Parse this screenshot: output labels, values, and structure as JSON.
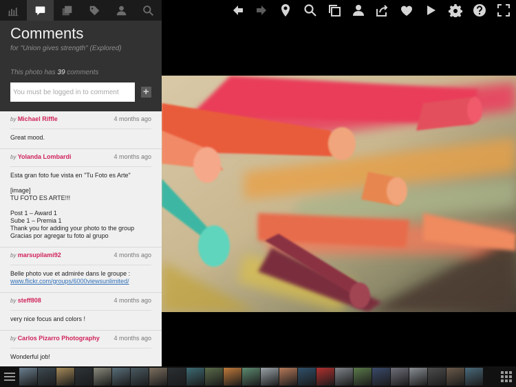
{
  "panel_tabs": [
    {
      "name": "stats-tab",
      "icon": "bar-chart-icon",
      "active": false
    },
    {
      "name": "comments-tab",
      "icon": "speech-bubble-icon",
      "active": true
    },
    {
      "name": "sets-tab",
      "icon": "stacked-pages-icon",
      "active": false
    },
    {
      "name": "tags-tab",
      "icon": "tag-icon",
      "active": false
    },
    {
      "name": "people-tab",
      "icon": "person-icon",
      "active": false
    },
    {
      "name": "search-tab",
      "icon": "search-icon",
      "active": false
    }
  ],
  "comments": {
    "title": "Comments",
    "subtitle": "for \"Union gives strength\" (Explored)",
    "count_prefix": "This photo has",
    "count": "39",
    "count_suffix": "comments",
    "input_placeholder": "You must be logged in to comment",
    "add_label": "+",
    "by_label": "by",
    "items": [
      {
        "author": "Michael Riffle",
        "time": "4 months ago",
        "body": "Great mood.",
        "link": ""
      },
      {
        "author": "Yolanda Lombardi",
        "time": "4 months ago",
        "body": "Esta gran foto fue vista en \"Tu Foto es Arte\"\n\n[image]\nTU FOTO ES ARTE!!!\n\nPost 1 – Award 1\nSube 1 – Premia 1\nThank you for adding your photo to the group\nGracias por agregar tu foto al grupo",
        "link": ""
      },
      {
        "author": "marsupilami92",
        "time": "4 months ago",
        "body": "Belle photo vue et admirée dans le groupe :",
        "link": "www.flickr.com/groups/6000viewsunlimited/"
      },
      {
        "author": "steff808",
        "time": "4 months ago",
        "body": "very nice focus and colors !",
        "link": ""
      },
      {
        "author": "Carlos Pizarro Photography",
        "time": "4 months ago",
        "body": "Wonderful job!",
        "link": ""
      }
    ]
  },
  "toolbar": {
    "icons": [
      "back-arrow-icon",
      "forward-arrow-icon",
      "location-pin-icon",
      "zoom-icon",
      "copy-icon",
      "user-icon",
      "share-icon",
      "heart-icon",
      "play-icon",
      "settings-gear-icon",
      "help-icon",
      "fullscreen-icon"
    ]
  },
  "filmstrip": {
    "menu_icon": "menu-icon",
    "grid_icon": "grid-icon"
  },
  "colors": {
    "accent": "#d0245b",
    "link": "#2f6fb8",
    "panel_bg": "#323232",
    "list_bg": "#f0f0f0"
  }
}
